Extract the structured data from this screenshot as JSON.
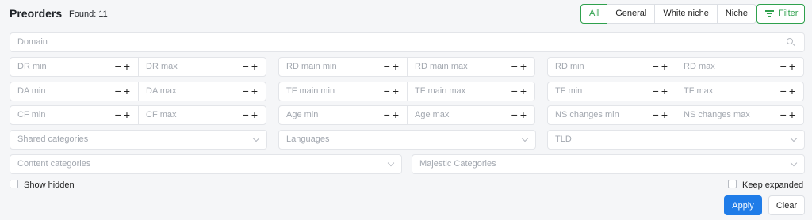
{
  "header": {
    "title": "Preorders",
    "found": "Found: 11",
    "tabs": [
      "All",
      "General",
      "White niche",
      "Niche"
    ],
    "active_tab": "All",
    "filter_label": "Filter"
  },
  "domain": {
    "placeholder": "Domain",
    "icon": "search-icon"
  },
  "ranges": [
    [
      "DR min",
      "DR max",
      "RD main min",
      "RD main max",
      "RD min",
      "RD max"
    ],
    [
      "DA min",
      "DA max",
      "TF main min",
      "TF main max",
      "TF min",
      "TF max"
    ],
    [
      "CF min",
      "CF max",
      "Age min",
      "Age max",
      "NS changes min",
      "NS changes max"
    ]
  ],
  "stepper_symbols": "−+",
  "selects": {
    "shared_categories": "Shared categories",
    "languages": "Languages",
    "tld": "TLD",
    "content_categories": "Content categories",
    "majestic_categories": "Majestic Categories"
  },
  "checkboxes": {
    "show_hidden": "Show hidden",
    "keep_expanded": "Keep expanded"
  },
  "actions": {
    "apply": "Apply",
    "clear": "Clear"
  },
  "colors": {
    "accent_green": "#2fa14d",
    "primary_blue": "#1f7ce8",
    "background": "#f5f6f8"
  }
}
